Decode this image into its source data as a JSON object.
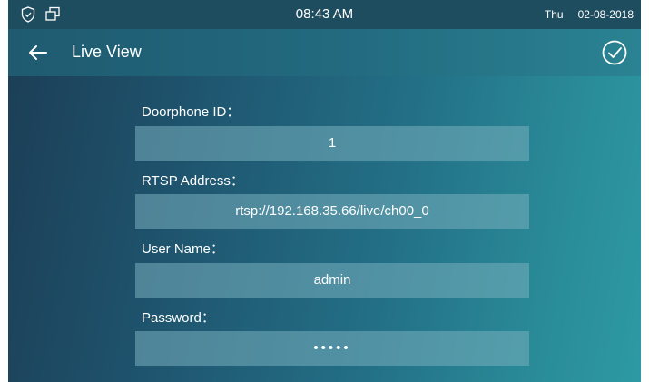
{
  "statusbar": {
    "icons": [
      "shield-icon",
      "windows-icon"
    ],
    "time": "08:43 AM",
    "day": "Thu",
    "date": "02-08-2018"
  },
  "appbar": {
    "back_icon": "arrow-left-icon",
    "title": "Live View",
    "confirm_icon": "check-circle-icon"
  },
  "form": {
    "doorphone_id": {
      "label": "Doorphone ID：",
      "value": "1"
    },
    "rtsp_address": {
      "label": "RTSP Address：",
      "value": "rtsp://192.168.35.66/live/ch00_0"
    },
    "user_name": {
      "label": "User Name：",
      "value": "admin"
    },
    "password": {
      "label": "Password：",
      "value": "•••••"
    }
  },
  "colors": {
    "statusbar": "#1f4d60",
    "field_bg": "#78afbe",
    "text": "#ffffff"
  }
}
